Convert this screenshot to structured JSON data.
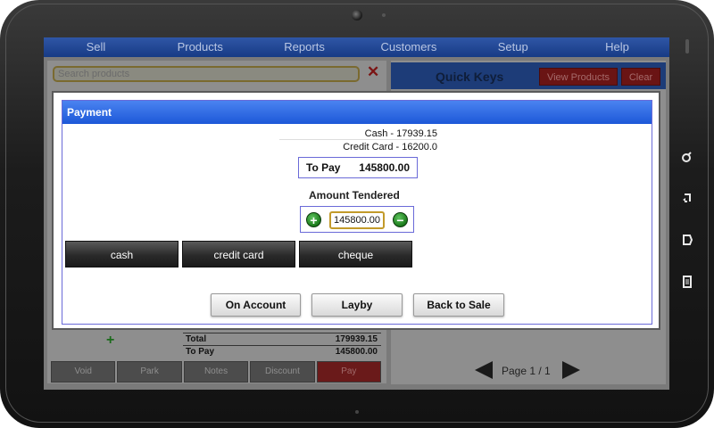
{
  "menubar": {
    "items": [
      "Sell",
      "Products",
      "Reports",
      "Customers",
      "Setup",
      "Help"
    ]
  },
  "left_panel": {
    "search_placeholder": "Search products",
    "clear_symbol": "✕",
    "totals": [
      {
        "label": "Total",
        "value": "179939.15"
      },
      {
        "label": "To Pay",
        "value": "145800.00"
      }
    ],
    "bottom_buttons": [
      "Void",
      "Park",
      "Notes",
      "Discount",
      "Pay"
    ]
  },
  "quick_keys": {
    "title": "Quick Keys",
    "view_products_label": "View Products",
    "clear_label": "Clear"
  },
  "pager": {
    "label": "Page 1 / 1"
  },
  "dialog": {
    "title": "Payment",
    "payments": [
      "Cash - 17939.15",
      "Credit Card - 16200.0"
    ],
    "to_pay_label": "To Pay",
    "to_pay_value": "145800.00",
    "amount_tendered_label": "Amount Tendered",
    "amount_value": "145800.00",
    "methods": [
      "cash",
      "credit card",
      "cheque"
    ],
    "actions": [
      "On Account",
      "Layby",
      "Back to Sale"
    ]
  },
  "colors": {
    "dialog_title": "#2a62e0",
    "menubar": "#1f468f",
    "pay_button": "#6a1a1a",
    "accent_green": "#1b7a1b"
  },
  "icons": {
    "hardware_keys": [
      "search-icon",
      "back-icon",
      "home-icon",
      "menu-icon"
    ],
    "add": "plus-icon",
    "remove": "minus-icon"
  }
}
